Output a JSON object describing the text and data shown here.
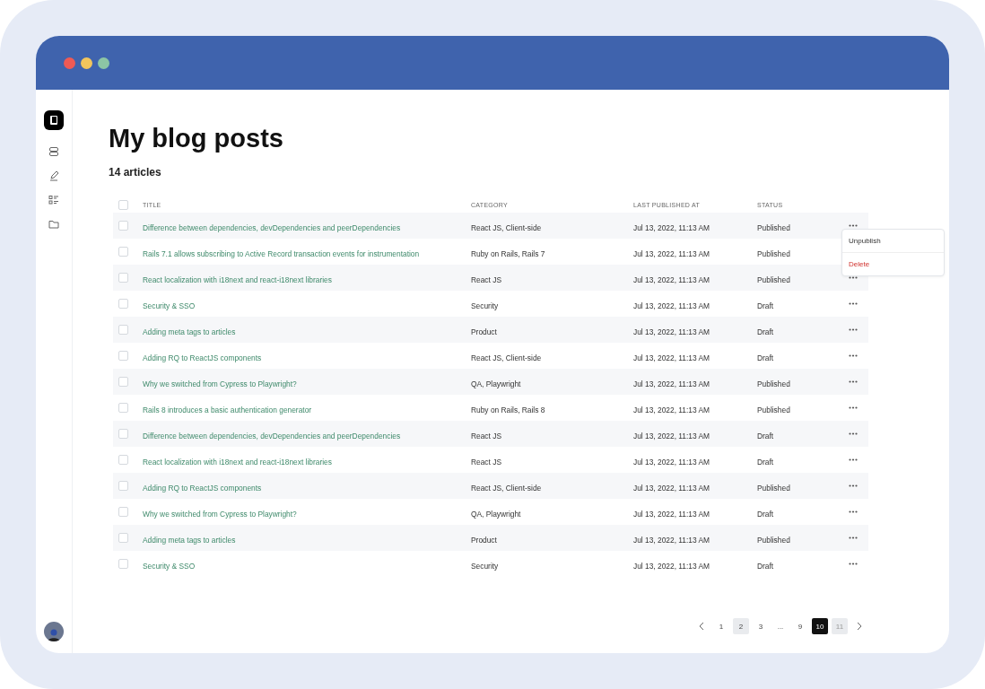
{
  "window": {
    "controls": [
      {
        "color": "#ee5a55"
      },
      {
        "color": "#f2c55c"
      },
      {
        "color": "#8cc5a5"
      }
    ]
  },
  "page": {
    "title": "My blog posts",
    "count": "14 articles"
  },
  "table": {
    "columns": [
      "TITLE",
      "CATEGORY",
      "LAST PUBLISHED AT",
      "STATUS"
    ],
    "rows": [
      {
        "title": "Difference between dependencies, devDependencies and peerDependencies",
        "category": "React JS, Client-side",
        "published_at": "Jul 13, 2022, 11:13 AM",
        "status": "Published",
        "checked": false
      },
      {
        "title": "Rails 7.1 allows subscribing to Active Record transaction events for instrumentation",
        "category": "Ruby on Rails,  Rails 7",
        "published_at": "Jul 13, 2022, 11:13 AM",
        "status": "Published",
        "checked": false
      },
      {
        "title": "React localization with i18next and react-i18next libraries",
        "category": "React JS",
        "published_at": "Jul 13, 2022, 11:13 AM",
        "status": "Published",
        "checked": false
      },
      {
        "title": "Security & SSO",
        "category": "Security",
        "published_at": "Jul 13, 2022, 11:13 AM",
        "status": "Draft",
        "checked": false
      },
      {
        "title": "Adding meta tags to articles",
        "category": "Product",
        "published_at": "Jul 13, 2022, 11:13 AM",
        "status": "Draft",
        "checked": false
      },
      {
        "title": "Adding RQ to ReactJS components",
        "category": "React JS, Client-side",
        "published_at": "Jul 13, 2022, 11:13 AM",
        "status": "Draft",
        "checked": false
      },
      {
        "title": "Why we switched from Cypress to Playwright?",
        "category": "QA, Playwright",
        "published_at": "Jul 13, 2022, 11:13 AM",
        "status": "Published",
        "checked": false
      },
      {
        "title": "Rails 8 introduces a basic authentication generator",
        "category": "Ruby on Rails,  Rails 8",
        "published_at": "Jul 13, 2022, 11:13 AM",
        "status": "Published",
        "checked": false
      },
      {
        "title": "Difference between dependencies, devDependencies and peerDependencies",
        "category": "React JS",
        "published_at": "Jul 13, 2022, 11:13 AM",
        "status": "Draft",
        "checked": false
      },
      {
        "title": "React localization with i18next and react-i18next libraries",
        "category": "React JS",
        "published_at": "Jul 13, 2022, 11:13 AM",
        "status": "Draft",
        "checked": false
      },
      {
        "title": "Adding RQ to ReactJS components",
        "category": "React JS, Client-side",
        "published_at": "Jul 13, 2022, 11:13 AM",
        "status": "Published",
        "checked": false
      },
      {
        "title": "Why we switched from Cypress to Playwright?",
        "category": "QA, Playwright",
        "published_at": "Jul 13, 2022, 11:13 AM",
        "status": "Draft",
        "checked": false
      },
      {
        "title": "Adding meta tags to articles",
        "category": "Product",
        "published_at": "Jul 13, 2022, 11:13 AM",
        "status": "Published",
        "checked": false
      },
      {
        "title": "Security & SSO",
        "category": "Security",
        "published_at": "Jul 13, 2022, 11:13 AM",
        "status": "Draft",
        "checked": false
      }
    ],
    "header_checked": false
  },
  "row_menu": {
    "items": [
      {
        "label": "Unpublish",
        "kind": "normal"
      },
      {
        "label": "Delete",
        "kind": "danger"
      }
    ]
  },
  "pagination": {
    "pages": [
      {
        "label": "1",
        "selected": false,
        "shaded": false
      },
      {
        "label": "2",
        "selected": false,
        "shaded": true
      },
      {
        "label": "3",
        "selected": false,
        "shaded": false
      },
      {
        "label": "...",
        "selected": false,
        "shaded": false
      },
      {
        "label": "9",
        "selected": false,
        "shaded": false
      },
      {
        "label": "10",
        "selected": true,
        "shaded": false
      },
      {
        "label": "11",
        "selected": false,
        "shaded": true
      }
    ]
  }
}
